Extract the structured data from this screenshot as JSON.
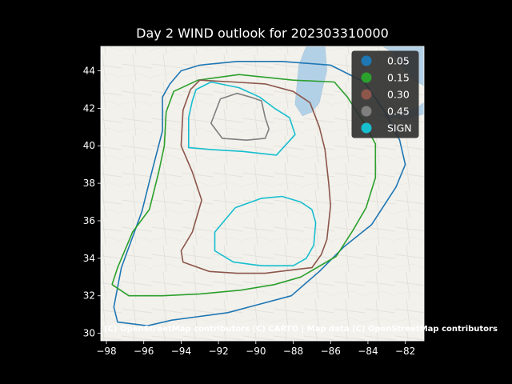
{
  "title": "Day 2 WIND outlook for 202303310000",
  "attribution": "(C) OpenStreetMap contributors (C) CARTO | Map data (C) OpenStreetMap contributors",
  "chart_data": {
    "type": "map-contours",
    "xlim": [
      -98.3,
      -81.0
    ],
    "ylim": [
      29.6,
      45.3
    ],
    "xticks": [
      -98,
      -96,
      -94,
      -92,
      -90,
      -88,
      -86,
      -84,
      -82
    ],
    "yticks": [
      30,
      32,
      34,
      36,
      38,
      40,
      42,
      44
    ],
    "legend_position": "top-right",
    "series": [
      {
        "name": "0.05",
        "color": "#1f77b4",
        "coords": [
          [
            -95.8,
            30.4
          ],
          [
            -97.4,
            30.6
          ],
          [
            -97.6,
            31.4
          ],
          [
            -97.2,
            33.5
          ],
          [
            -96.1,
            36.5
          ],
          [
            -95.6,
            38.5
          ],
          [
            -95.0,
            40.8
          ],
          [
            -95.0,
            42.6
          ],
          [
            -94.6,
            43.3
          ],
          [
            -94.0,
            44.0
          ],
          [
            -93.0,
            44.3
          ],
          [
            -91.0,
            44.5
          ],
          [
            -88.6,
            44.5
          ],
          [
            -86.0,
            44.3
          ],
          [
            -84.2,
            43.4
          ],
          [
            -83.1,
            41.8
          ],
          [
            -82.3,
            40.3
          ],
          [
            -82.0,
            39.0
          ],
          [
            -82.5,
            37.8
          ],
          [
            -83.8,
            35.8
          ],
          [
            -85.3,
            34.6
          ],
          [
            -86.6,
            33.3
          ],
          [
            -88.1,
            32.0
          ],
          [
            -90.0,
            31.5
          ],
          [
            -91.5,
            31.1
          ],
          [
            -93.0,
            30.9
          ],
          [
            -94.5,
            30.7
          ],
          [
            -95.8,
            30.4
          ]
        ]
      },
      {
        "name": "0.15",
        "color": "#2ca02c",
        "coords": [
          [
            -97.7,
            32.6
          ],
          [
            -97.4,
            33.5
          ],
          [
            -96.6,
            35.4
          ],
          [
            -95.7,
            36.6
          ],
          [
            -95.2,
            38.6
          ],
          [
            -94.9,
            40.0
          ],
          [
            -94.8,
            41.8
          ],
          [
            -94.4,
            42.9
          ],
          [
            -93.1,
            43.5
          ],
          [
            -90.9,
            43.8
          ],
          [
            -88.0,
            43.5
          ],
          [
            -85.8,
            43.4
          ],
          [
            -85.1,
            42.6
          ],
          [
            -84.2,
            41.2
          ],
          [
            -83.6,
            40.1
          ],
          [
            -83.6,
            38.3
          ],
          [
            -84.1,
            36.7
          ],
          [
            -84.8,
            35.5
          ],
          [
            -85.7,
            34.1
          ],
          [
            -87.6,
            33.0
          ],
          [
            -89.0,
            32.6
          ],
          [
            -90.8,
            32.3
          ],
          [
            -93.0,
            32.1
          ],
          [
            -95.0,
            32.0
          ],
          [
            -96.8,
            32.0
          ],
          [
            -97.7,
            32.6
          ]
        ]
      },
      {
        "name": "0.30",
        "color": "#8c564b",
        "coords": [
          [
            -93.5,
            43.0
          ],
          [
            -93.0,
            43.5
          ],
          [
            -91.2,
            43.4
          ],
          [
            -89.5,
            43.3
          ],
          [
            -88.0,
            42.9
          ],
          [
            -87.1,
            42.3
          ],
          [
            -86.6,
            41.0
          ],
          [
            -86.3,
            39.8
          ],
          [
            -86.1,
            38.0
          ],
          [
            -86.0,
            36.8
          ],
          [
            -86.2,
            35.0
          ],
          [
            -86.5,
            34.2
          ],
          [
            -87.0,
            33.5
          ],
          [
            -87.9,
            33.4
          ],
          [
            -89.5,
            33.2
          ],
          [
            -91.0,
            33.2
          ],
          [
            -92.5,
            33.3
          ],
          [
            -93.9,
            33.8
          ],
          [
            -94.0,
            34.4
          ],
          [
            -93.4,
            35.4
          ],
          [
            -92.9,
            37.1
          ],
          [
            -93.4,
            38.6
          ],
          [
            -94.0,
            40.0
          ],
          [
            -93.9,
            41.9
          ],
          [
            -93.5,
            43.0
          ]
        ]
      },
      {
        "name": "0.45",
        "color": "#7f7f7f",
        "coords": [
          [
            -91.9,
            42.5
          ],
          [
            -91.0,
            42.8
          ],
          [
            -90.3,
            42.6
          ],
          [
            -89.7,
            42.4
          ],
          [
            -89.5,
            41.5
          ],
          [
            -89.3,
            40.9
          ],
          [
            -89.5,
            40.4
          ],
          [
            -90.5,
            40.3
          ],
          [
            -91.8,
            40.4
          ],
          [
            -92.4,
            41.2
          ],
          [
            -91.9,
            42.5
          ]
        ]
      },
      {
        "name": "SIGN",
        "color": "#17becf",
        "coords": [
          [
            -93.2,
            43.0
          ],
          [
            -92.4,
            43.4
          ],
          [
            -90.9,
            43.1
          ],
          [
            -89.8,
            42.6
          ],
          [
            -89.0,
            42.0
          ],
          [
            -88.2,
            41.5
          ],
          [
            -87.9,
            40.6
          ],
          [
            -88.9,
            39.5
          ],
          [
            -90.7,
            39.7
          ],
          [
            -92.4,
            39.8
          ],
          [
            -93.6,
            39.9
          ],
          [
            -93.6,
            41.5
          ],
          [
            -93.4,
            42.4
          ],
          [
            -93.2,
            43.0
          ]
        ]
      },
      {
        "name": "SIGN",
        "color": "#17becf",
        "coords": [
          [
            -91.1,
            36.7
          ],
          [
            -89.7,
            37.2
          ],
          [
            -88.6,
            37.3
          ],
          [
            -87.6,
            37.0
          ],
          [
            -87.0,
            36.6
          ],
          [
            -86.8,
            35.9
          ],
          [
            -86.9,
            34.7
          ],
          [
            -87.3,
            34.0
          ],
          [
            -88.0,
            33.6
          ],
          [
            -89.7,
            33.6
          ],
          [
            -91.2,
            33.8
          ],
          [
            -92.2,
            34.4
          ],
          [
            -92.2,
            35.4
          ],
          [
            -91.1,
            36.7
          ]
        ]
      }
    ],
    "legend": [
      {
        "label": "0.05",
        "color": "#1f77b4"
      },
      {
        "label": "0.15",
        "color": "#2ca02c"
      },
      {
        "label": "0.30",
        "color": "#8c564b"
      },
      {
        "label": "0.45",
        "color": "#7f7f7f"
      },
      {
        "label": "SIGN",
        "color": "#17becf"
      }
    ],
    "basemap": {
      "lake_color": "#b3d1e6",
      "land_color": "#f2f1ec",
      "water_coords": [
        [
          [
            -87.9,
            42.2
          ],
          [
            -87.8,
            43.2
          ],
          [
            -87.7,
            44.3
          ],
          [
            -87.3,
            45.3
          ],
          [
            -86.3,
            45.3
          ],
          [
            -86.2,
            44.0
          ],
          [
            -86.4,
            43.2
          ],
          [
            -86.6,
            42.3
          ],
          [
            -87.0,
            41.8
          ],
          [
            -87.5,
            41.6
          ],
          [
            -87.9,
            42.2
          ]
        ],
        [
          [
            -83.2,
            45.3
          ],
          [
            -82.7,
            45.0
          ],
          [
            -82.2,
            44.2
          ],
          [
            -81.7,
            43.6
          ],
          [
            -81.0,
            43.2
          ],
          [
            -81.0,
            45.3
          ],
          [
            -83.2,
            45.3
          ]
        ],
        [
          [
            -83.5,
            41.7
          ],
          [
            -82.5,
            41.7
          ],
          [
            -81.4,
            42.0
          ],
          [
            -81.0,
            42.3
          ],
          [
            -81.0,
            41.7
          ],
          [
            -82.0,
            41.4
          ],
          [
            -83.0,
            41.5
          ],
          [
            -83.5,
            41.7
          ]
        ]
      ]
    }
  }
}
